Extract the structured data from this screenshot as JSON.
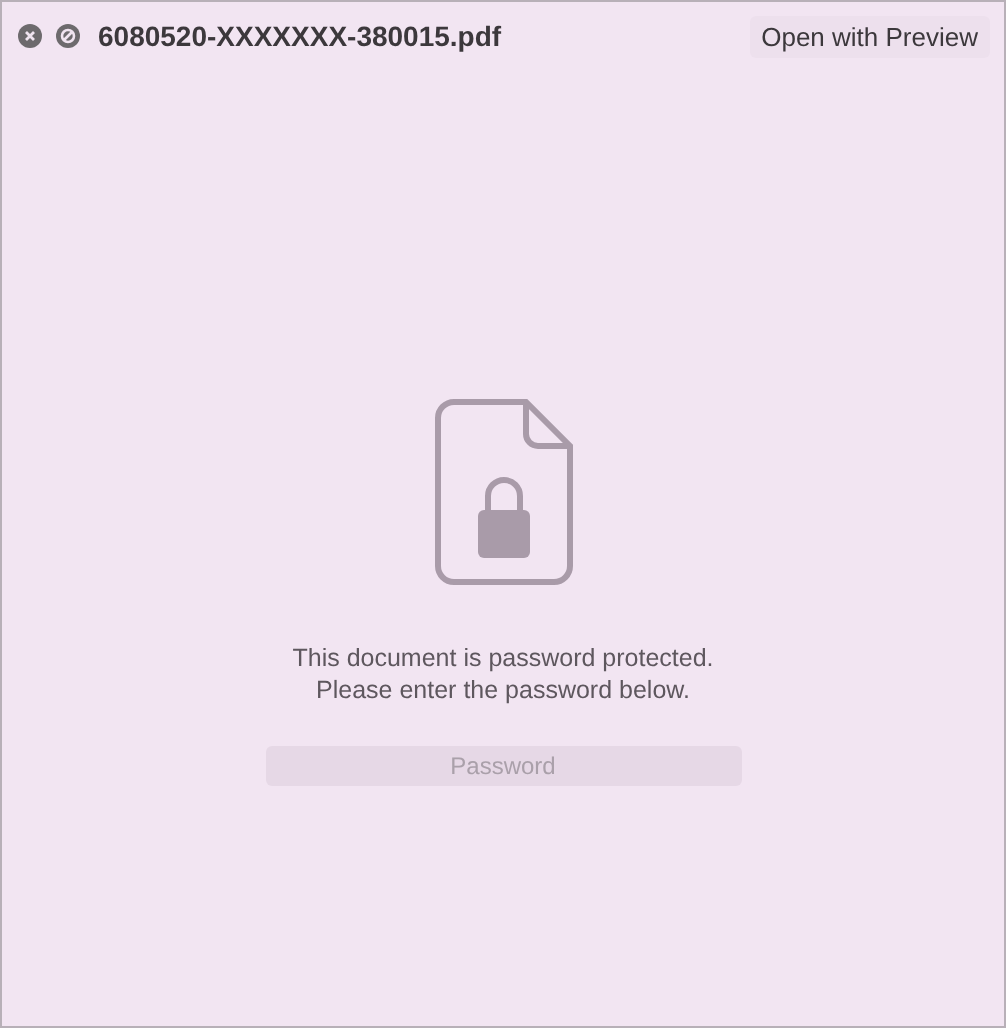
{
  "window": {
    "filename": "6080520-XXXXXXX-380015.pdf"
  },
  "toolbar": {
    "button": "Open with Preview"
  },
  "message": [
    "This document is password protected.",
    "Please enter the password below."
  ],
  "password_field": {
    "placeholder": "Password"
  }
}
